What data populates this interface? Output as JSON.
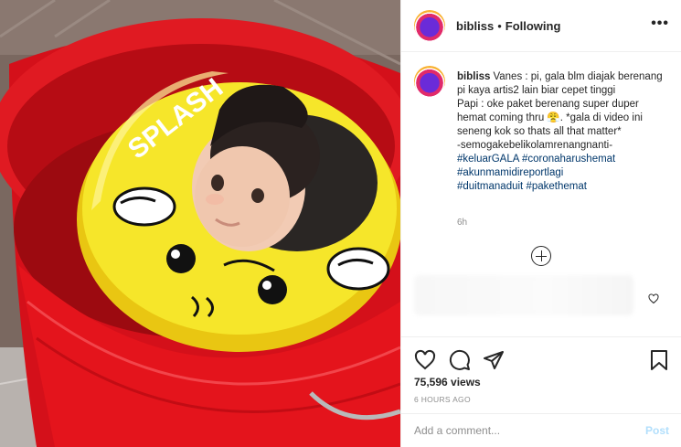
{
  "post": {
    "photo_alt": "",
    "header": {
      "username": "bibliss",
      "separator": "•",
      "follow_status": "Following",
      "more_icon": "more-horizontal-icon"
    },
    "caption": {
      "username": "bibliss",
      "text_line1": "Vanes : pi, gala blm diajak berenang pi kaya artis2 lain biar cepet tinggi",
      "text_line2": "Papi : oke paket berenang super duper hemat coming thru 😤. *gala di video ini seneng kok so thats all that matter*",
      "text_line3": "-semogakebelikolamrenangnanti-",
      "hashtags_line1_a": "#keluarGALA",
      "hashtags_line1_b": "#coronaharushemat",
      "hashtags_line2": "#akunmamidireportlagi",
      "hashtags_line3_a": "#duitmanaduit",
      "hashtags_line3_b": "#pakethemat",
      "time": "6h"
    },
    "load_more_icon": "plus-circle-icon",
    "like_comment_icon": "heart-small-icon",
    "actions": {
      "like_icon": "heart-icon",
      "comment_icon": "comment-icon",
      "share_icon": "paper-plane-icon",
      "save_icon": "bookmark-icon"
    },
    "views": "75,596 views",
    "timestamp": "6 HOURS AGO",
    "comment": {
      "placeholder": "Add a comment...",
      "post_label": "Post"
    }
  },
  "colors": {
    "link": "#00376b",
    "muted": "#8e8e8e",
    "post_disabled": "#b2dffc",
    "bucket_red": "#e0141b",
    "float_yellow": "#f3e21f"
  }
}
